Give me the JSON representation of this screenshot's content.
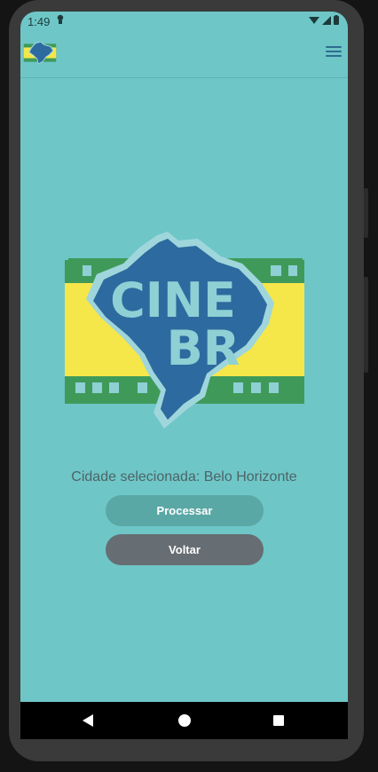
{
  "status_bar": {
    "time": "1:49",
    "extra_icon": "alien-icon",
    "icons": [
      "wifi-icon",
      "signal-icon",
      "battery-icon"
    ]
  },
  "app_bar": {
    "logo_icon": "cine-br-logo",
    "menu_icon": "hamburger-menu-icon"
  },
  "main": {
    "logo": {
      "line1": "CINE",
      "line2": "BR"
    },
    "city_label": "Cidade selecionada: Belo Horizonte",
    "process_button": "Processar",
    "back_button": "Voltar"
  },
  "nav_bar": {
    "icons": [
      "back-triangle-icon",
      "home-circle-icon",
      "recents-square-icon"
    ]
  },
  "colors": {
    "background": "#6ec6c7",
    "primary_button": "#5aa8a5",
    "secondary_button": "#666d73",
    "logo_blue": "#2d6a9f",
    "logo_green": "#3f9a5a",
    "logo_yellow": "#f5e64a"
  }
}
